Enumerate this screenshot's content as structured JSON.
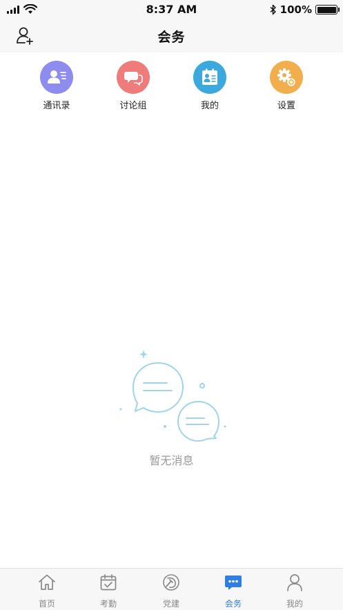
{
  "status_bar": {
    "time": "8:37 AM",
    "battery": "100%",
    "icons": [
      "signal-icon",
      "wifi-icon",
      "bluetooth-icon",
      "battery-icon"
    ]
  },
  "header": {
    "title": "会务",
    "left_icon": "add-user-icon"
  },
  "shortcuts": [
    {
      "label": "通讯录",
      "icon": "contacts-icon",
      "color": "#8f8cf0"
    },
    {
      "label": "讨论组",
      "icon": "discussion-icon",
      "color": "#ef7b7b"
    },
    {
      "label": "我的",
      "icon": "my-card-icon",
      "color": "#3ba8de"
    },
    {
      "label": "设置",
      "icon": "settings-icon",
      "color": "#f2ae4c"
    }
  ],
  "empty_state": {
    "text": "暂无消息",
    "icon": "chat-bubbles-icon",
    "color": "#9fd3f0"
  },
  "tabbar": {
    "active_color": "#2f7fe0",
    "items": [
      {
        "label": "首页",
        "icon": "home-icon",
        "active": false
      },
      {
        "label": "考勤",
        "icon": "calendar-check-icon",
        "active": false
      },
      {
        "label": "党建",
        "icon": "party-emblem-icon",
        "active": false
      },
      {
        "label": "会务",
        "icon": "chat-dots-icon",
        "active": true
      },
      {
        "label": "我的",
        "icon": "person-icon",
        "active": false
      }
    ]
  }
}
